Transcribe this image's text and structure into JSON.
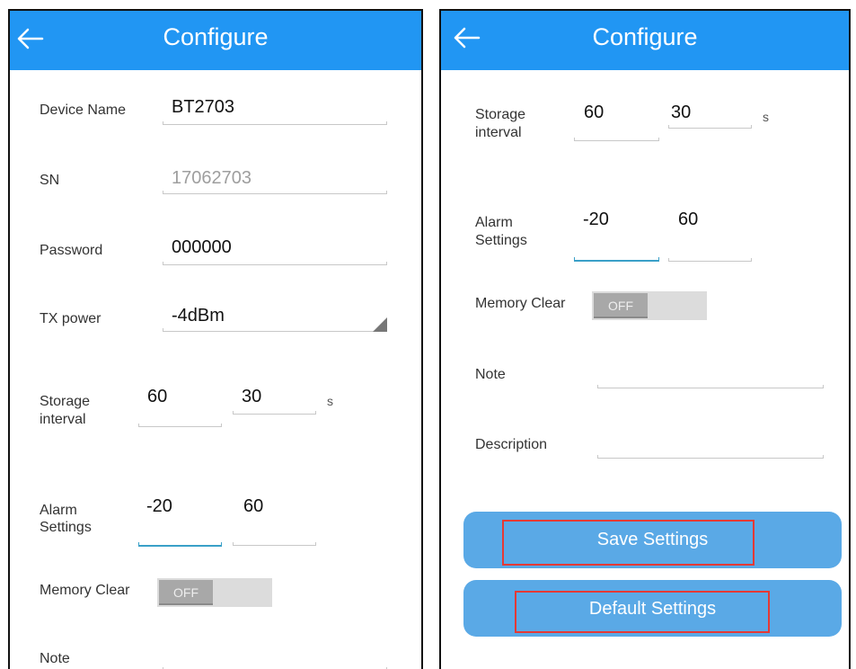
{
  "left": {
    "title": "Configure",
    "device_name": {
      "label": "Device Name",
      "value": "BT2703"
    },
    "sn": {
      "label": "SN",
      "value": "17062703"
    },
    "password": {
      "label": "Password",
      "value": "000000"
    },
    "tx_power": {
      "label": "TX power",
      "value": "-4dBm"
    },
    "storage": {
      "label_1": "Storage",
      "label_2": "interval",
      "value_1": "60",
      "value_2": "30",
      "unit": "s"
    },
    "alarm": {
      "label_1": "Alarm",
      "label_2": "Settings",
      "low": "-20",
      "high": "60"
    },
    "memory_clear": {
      "label": "Memory Clear",
      "toggle": "OFF"
    },
    "note": {
      "label": "Note"
    }
  },
  "right": {
    "title": "Configure",
    "storage": {
      "label_1": "Storage",
      "label_2": "interval",
      "value_1": "60",
      "value_2": "30",
      "unit": "s"
    },
    "alarm": {
      "label_1": "Alarm",
      "label_2": "Settings",
      "low": "-20",
      "high": "60"
    },
    "memory_clear": {
      "label": "Memory Clear",
      "toggle": "OFF"
    },
    "note": {
      "label": "Note",
      "value": ""
    },
    "description": {
      "label": "Description",
      "value": ""
    },
    "save_label": "Save Settings",
    "default_label": "Default Settings"
  },
  "colors": {
    "appbar": "#2196f3",
    "button": "#5aa9e6",
    "highlight": "#e53935",
    "active_underline": "#3aa0c8"
  }
}
